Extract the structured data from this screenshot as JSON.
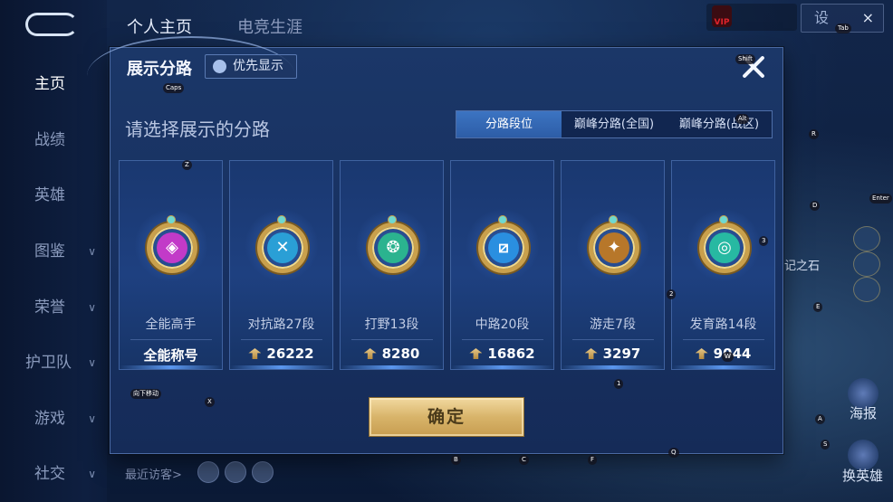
{
  "background": {
    "top_tabs": [
      "个人主页",
      "电竞生涯"
    ],
    "top_right_button": {
      "label": "设",
      "close": "×"
    },
    "vip_label": "VIP",
    "left_nav": [
      {
        "label": "主页",
        "active": true,
        "chevron": false
      },
      {
        "label": "战绩",
        "active": false,
        "chevron": false
      },
      {
        "label": "英雄",
        "active": false,
        "chevron": false
      },
      {
        "label": "图鉴",
        "active": false,
        "chevron": true
      },
      {
        "label": "荣誉",
        "active": false,
        "chevron": true
      },
      {
        "label": "护卫队",
        "active": false,
        "chevron": true
      },
      {
        "label": "游戏",
        "active": false,
        "chevron": true
      },
      {
        "label": "社交",
        "active": false,
        "chevron": true
      }
    ],
    "recent_visitors_label": "最近访客>",
    "side_texts": {
      "stone": "记之石",
      "poster": "海报",
      "swap_hero": "换英雄"
    }
  },
  "key_hints": [
    "Caps",
    "Z",
    "X",
    "Shift",
    "Tab",
    "Alt",
    "R",
    "D",
    "Enter",
    "3",
    "2",
    "E",
    "W",
    "1",
    "A",
    "S",
    "B",
    "C",
    "F",
    "Q",
    "向下移动"
  ],
  "dialog": {
    "title": "展示分路",
    "priority_button": "优先显示",
    "subtitle": "请选择展示的分路",
    "tabs": [
      {
        "label": "分路段位",
        "active": true
      },
      {
        "label": "巅峰分路(全国)",
        "active": false
      },
      {
        "label": "巅峰分路(战区)",
        "active": false
      }
    ],
    "cards": [
      {
        "name": "全能高手",
        "value": "全能称号",
        "has_points_icon": false,
        "emblem_color": "#c23ac8",
        "emblem_icon": "diamond-rune-icon",
        "glyph": "◈"
      },
      {
        "name": "对抗路27段",
        "value": "26222",
        "has_points_icon": true,
        "emblem_color": "#2a9fd6",
        "emblem_icon": "crossed-swords-icon",
        "glyph": "✕"
      },
      {
        "name": "打野13段",
        "value": "8280",
        "has_points_icon": true,
        "emblem_color": "#2bb38f",
        "emblem_icon": "dragon-claw-icon",
        "glyph": "❂"
      },
      {
        "name": "中路20段",
        "value": "16862",
        "has_points_icon": true,
        "emblem_color": "#2a8fe0",
        "emblem_icon": "slash-square-icon",
        "glyph": "⧄"
      },
      {
        "name": "游走7段",
        "value": "3297",
        "has_points_icon": true,
        "emblem_color": "#b7772a",
        "emblem_icon": "wings-icon",
        "glyph": "✦"
      },
      {
        "name": "发育路14段",
        "value": "9044",
        "has_points_icon": true,
        "emblem_color": "#27b9a2",
        "emblem_icon": "target-square-icon",
        "glyph": "◎"
      }
    ],
    "confirm_button": "确定"
  }
}
